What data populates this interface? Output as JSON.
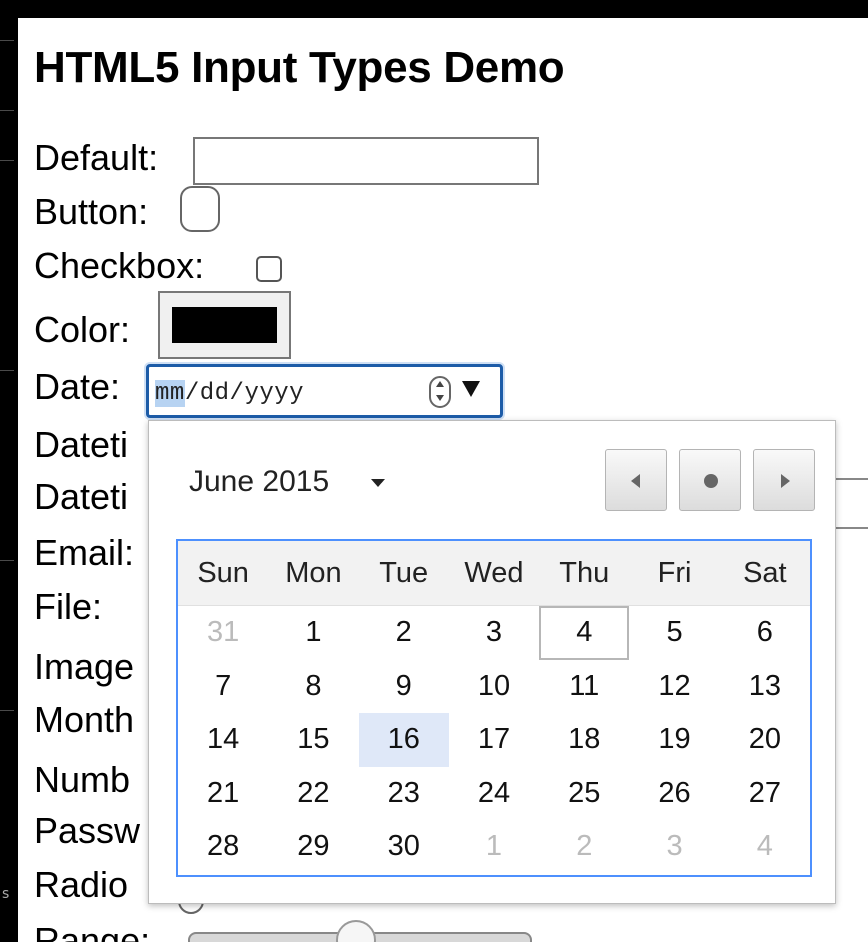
{
  "page": {
    "title": "HTML5 Input Types Demo",
    "rows": [
      "Default:",
      "Button:",
      "Checkbox:",
      "Color:",
      "Date:",
      "Dateti",
      "Dateti",
      "Email:",
      "File:",
      "Image",
      "Month",
      "Numb",
      "Passw",
      "Radio",
      "Range:"
    ]
  },
  "inputs": {
    "default_value": "",
    "checkbox_checked": false,
    "color_value": "#000000",
    "date_placeholder": {
      "mm": "mm",
      "sep1": "/",
      "dd": "dd",
      "sep2": "/",
      "yyyy": "yyyy"
    },
    "range_value_fraction": 0.52
  },
  "datepicker": {
    "month_label": "June 2015",
    "weekdays": [
      "Sun",
      "Mon",
      "Tue",
      "Wed",
      "Thu",
      "Fri",
      "Sat"
    ],
    "weeks": [
      [
        {
          "d": "31",
          "o": true
        },
        {
          "d": "1"
        },
        {
          "d": "2"
        },
        {
          "d": "3"
        },
        {
          "d": "4",
          "today": true
        },
        {
          "d": "5"
        },
        {
          "d": "6"
        }
      ],
      [
        {
          "d": "7"
        },
        {
          "d": "8"
        },
        {
          "d": "9"
        },
        {
          "d": "10"
        },
        {
          "d": "11"
        },
        {
          "d": "12"
        },
        {
          "d": "13"
        }
      ],
      [
        {
          "d": "14"
        },
        {
          "d": "15"
        },
        {
          "d": "16",
          "sel": true
        },
        {
          "d": "17"
        },
        {
          "d": "18"
        },
        {
          "d": "19"
        },
        {
          "d": "20"
        }
      ],
      [
        {
          "d": "21"
        },
        {
          "d": "22"
        },
        {
          "d": "23"
        },
        {
          "d": "24"
        },
        {
          "d": "25"
        },
        {
          "d": "26"
        },
        {
          "d": "27"
        }
      ],
      [
        {
          "d": "28"
        },
        {
          "d": "29"
        },
        {
          "d": "30"
        },
        {
          "d": "1",
          "o": true
        },
        {
          "d": "2",
          "o": true
        },
        {
          "d": "3",
          "o": true
        },
        {
          "d": "4",
          "o": true
        }
      ]
    ],
    "today_day": "4",
    "selected_day": "16"
  },
  "colors": {
    "accent": "#4d90fe",
    "focus_border": "#1d5ca8",
    "selected_cell": "#dfe8f8",
    "other_month_text": "#bbbbbb"
  },
  "icons": {
    "spin": "spin-updown-icon",
    "dropdown": "dropdown-arrow-icon",
    "prev": "prev-month-icon",
    "today": "today-dot-icon",
    "next": "next-month-icon",
    "month_caret": "caret-down-icon"
  }
}
